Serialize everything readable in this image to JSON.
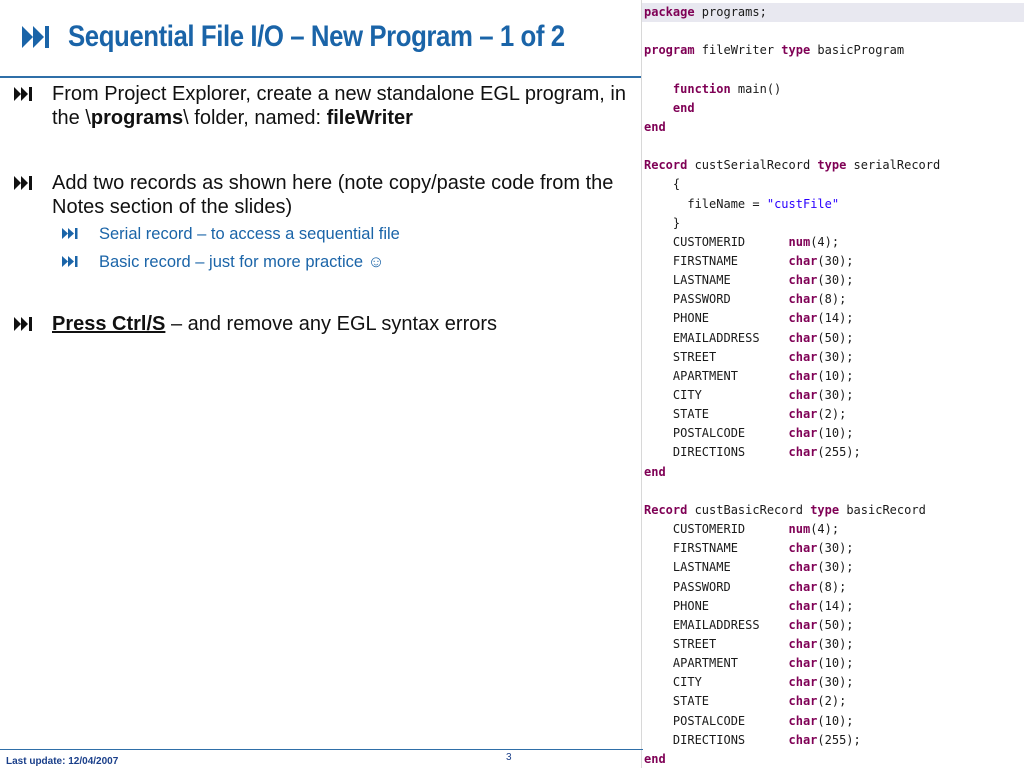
{
  "slide": {
    "title": "Sequential File I/O – New Program – 1 of 2",
    "footer_left": "Last update: 12/04/2007",
    "page_number": "3"
  },
  "bullets": {
    "b1": {
      "pre": "From Project Explorer, create a new standalone EGL program, in the \\",
      "bold1": "programs",
      "mid": "\\ folder, named: ",
      "bold2": "fileWriter"
    },
    "b2": {
      "text": "Add two records as shown here (note copy/paste code from the Notes section of the slides)"
    },
    "b2a": {
      "text": "Serial record – to access a sequential file"
    },
    "b2b": {
      "text": "Basic record – just for more practice ☺"
    },
    "b3": {
      "link": "Press Ctrl/S",
      "rest": " – and remove any EGL syntax errors"
    }
  },
  "code": {
    "lines": [
      {
        "indent": "",
        "kw": "package",
        "rest": " programs;"
      },
      {
        "indent": "",
        "kw": "",
        "rest": ""
      },
      {
        "indent": "",
        "kw": "program",
        "rest": " fileWriter ",
        "kw2": "type",
        "rest2": " basicProgram"
      },
      {
        "indent": "",
        "kw": "",
        "rest": ""
      },
      {
        "indent": "    ",
        "kw": "function",
        "rest": " main()"
      },
      {
        "indent": "    ",
        "kw": "end",
        "rest": ""
      },
      {
        "indent": "",
        "kw": "end",
        "rest": ""
      },
      {
        "indent": "",
        "kw": "",
        "rest": ""
      },
      {
        "indent": "",
        "kw": "Record",
        "rest": " custSerialRecord ",
        "kw2": "type",
        "rest2": " serialRecord"
      },
      {
        "indent": "    ",
        "kw": "",
        "rest": "{"
      },
      {
        "indent": "      ",
        "kw": "",
        "rest": "fileName = ",
        "str": "\"custFile\""
      },
      {
        "indent": "    ",
        "kw": "",
        "rest": "}"
      },
      {
        "indent": "    ",
        "kw": "",
        "rest": "CUSTOMERID      ",
        "kw2": "num",
        "rest2": "(4);"
      },
      {
        "indent": "    ",
        "kw": "",
        "rest": "FIRSTNAME       ",
        "kw2": "char",
        "rest2": "(30);"
      },
      {
        "indent": "    ",
        "kw": "",
        "rest": "LASTNAME        ",
        "kw2": "char",
        "rest2": "(30);"
      },
      {
        "indent": "    ",
        "kw": "",
        "rest": "PASSWORD        ",
        "kw2": "char",
        "rest2": "(8);"
      },
      {
        "indent": "    ",
        "kw": "",
        "rest": "PHONE           ",
        "kw2": "char",
        "rest2": "(14);"
      },
      {
        "indent": "    ",
        "kw": "",
        "rest": "EMAILADDRESS    ",
        "kw2": "char",
        "rest2": "(50);"
      },
      {
        "indent": "    ",
        "kw": "",
        "rest": "STREET          ",
        "kw2": "char",
        "rest2": "(30);"
      },
      {
        "indent": "    ",
        "kw": "",
        "rest": "APARTMENT       ",
        "kw2": "char",
        "rest2": "(10);"
      },
      {
        "indent": "    ",
        "kw": "",
        "rest": "CITY            ",
        "kw2": "char",
        "rest2": "(30);"
      },
      {
        "indent": "    ",
        "kw": "",
        "rest": "STATE           ",
        "kw2": "char",
        "rest2": "(2);"
      },
      {
        "indent": "    ",
        "kw": "",
        "rest": "POSTALCODE      ",
        "kw2": "char",
        "rest2": "(10);"
      },
      {
        "indent": "    ",
        "kw": "",
        "rest": "DIRECTIONS      ",
        "kw2": "char",
        "rest2": "(255);"
      },
      {
        "indent": "",
        "kw": "end",
        "rest": ""
      },
      {
        "indent": "",
        "kw": "",
        "rest": ""
      },
      {
        "indent": "",
        "kw": "Record",
        "rest": " custBasicRecord ",
        "kw2": "type",
        "rest2": " basicRecord"
      },
      {
        "indent": "    ",
        "kw": "",
        "rest": "CUSTOMERID      ",
        "kw2": "num",
        "rest2": "(4);"
      },
      {
        "indent": "    ",
        "kw": "",
        "rest": "FIRSTNAME       ",
        "kw2": "char",
        "rest2": "(30);"
      },
      {
        "indent": "    ",
        "kw": "",
        "rest": "LASTNAME        ",
        "kw2": "char",
        "rest2": "(30);"
      },
      {
        "indent": "    ",
        "kw": "",
        "rest": "PASSWORD        ",
        "kw2": "char",
        "rest2": "(8);"
      },
      {
        "indent": "    ",
        "kw": "",
        "rest": "PHONE           ",
        "kw2": "char",
        "rest2": "(14);"
      },
      {
        "indent": "    ",
        "kw": "",
        "rest": "EMAILADDRESS    ",
        "kw2": "char",
        "rest2": "(50);"
      },
      {
        "indent": "    ",
        "kw": "",
        "rest": "STREET          ",
        "kw2": "char",
        "rest2": "(30);"
      },
      {
        "indent": "    ",
        "kw": "",
        "rest": "APARTMENT       ",
        "kw2": "char",
        "rest2": "(10);"
      },
      {
        "indent": "    ",
        "kw": "",
        "rest": "CITY            ",
        "kw2": "char",
        "rest2": "(30);"
      },
      {
        "indent": "    ",
        "kw": "",
        "rest": "STATE           ",
        "kw2": "char",
        "rest2": "(2);"
      },
      {
        "indent": "    ",
        "kw": "",
        "rest": "POSTALCODE      ",
        "kw2": "char",
        "rest2": "(10);"
      },
      {
        "indent": "    ",
        "kw": "",
        "rest": "DIRECTIONS      ",
        "kw2": "char",
        "rest2": "(255);"
      },
      {
        "indent": "",
        "kw": "end",
        "rest": ""
      }
    ]
  },
  "icons": {
    "bullet": "fast-forward-icon"
  },
  "colors": {
    "title": "#1a64a8",
    "keyword": "#7f0055",
    "string": "#2a00ff",
    "subbullet": "#1a64a8"
  }
}
